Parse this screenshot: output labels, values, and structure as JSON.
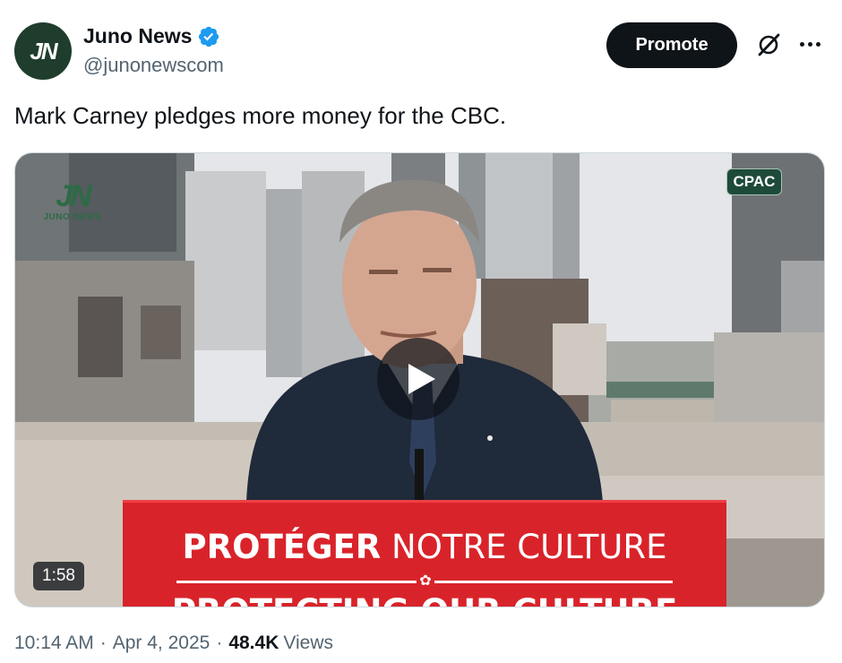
{
  "author": {
    "display_name": "Juno News",
    "handle": "@junonewscom",
    "avatar_text": "JN",
    "verified": true
  },
  "actions": {
    "promote_label": "Promote",
    "grok_icon": "grok-icon",
    "more_icon": "more-icon"
  },
  "tweet": {
    "text": "Mark Carney pledges more money for the CBC."
  },
  "media": {
    "type": "video",
    "duration": "1:58",
    "cpac_badge": "CPAC",
    "watermark_text": "JUNO NEWS",
    "podium_line1_bold": "PROTÉGER",
    "podium_line1_rest": " NOTRE CULTURE",
    "podium_line2": "PROTECTING OUR CULTURE",
    "play_icon": "play-icon"
  },
  "meta": {
    "time": "10:14 AM",
    "date": "Apr 4, 2025",
    "views_count": "48.4K",
    "views_label": "Views"
  },
  "colors": {
    "text_primary": "#0f1419",
    "text_secondary": "#536471",
    "verified_blue": "#1d9bf0",
    "podium_red": "#d9232a"
  }
}
